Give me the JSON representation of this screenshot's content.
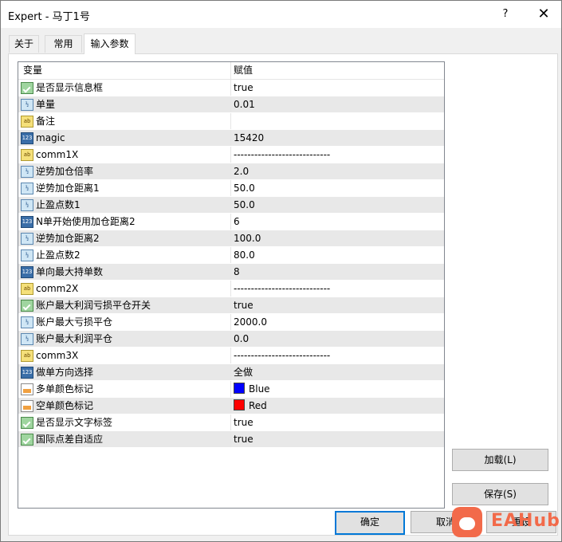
{
  "window": {
    "title": "Expert - 马丁1号",
    "help_icon": "?",
    "close_icon": "✕"
  },
  "tabs": [
    {
      "label": "关于",
      "active": false
    },
    {
      "label": "常用",
      "active": false
    },
    {
      "label": "输入参数",
      "active": true
    }
  ],
  "grid": {
    "headers": {
      "variable": "变量",
      "value": "赋值"
    },
    "rows": [
      {
        "icon": "bool-icon",
        "name": "是否显示信息框",
        "value": "true"
      },
      {
        "icon": "double-icon",
        "name": "单量",
        "value": "0.01"
      },
      {
        "icon": "string-icon",
        "name": "备注",
        "value": ""
      },
      {
        "icon": "int-icon",
        "name": "magic",
        "value": "15420"
      },
      {
        "icon": "string-icon",
        "name": "comm1X",
        "value": "----------------------------"
      },
      {
        "icon": "double-icon",
        "name": "逆势加仓倍率",
        "value": "2.0"
      },
      {
        "icon": "double-icon",
        "name": "逆势加仓距离1",
        "value": "50.0"
      },
      {
        "icon": "double-icon",
        "name": "止盈点数1",
        "value": "50.0"
      },
      {
        "icon": "int-icon",
        "name": "N单开始使用加仓距离2",
        "value": "6"
      },
      {
        "icon": "double-icon",
        "name": "逆势加仓距离2",
        "value": "100.0"
      },
      {
        "icon": "double-icon",
        "name": "止盈点数2",
        "value": "80.0"
      },
      {
        "icon": "int-icon",
        "name": "单向最大持单数",
        "value": "8"
      },
      {
        "icon": "string-icon",
        "name": "comm2X",
        "value": "----------------------------"
      },
      {
        "icon": "bool-icon",
        "name": "账户最大利润亏损平仓开关",
        "value": "true"
      },
      {
        "icon": "double-icon",
        "name": "账户最大亏损平仓",
        "value": "2000.0"
      },
      {
        "icon": "double-icon",
        "name": "账户最大利润平仓",
        "value": "0.0"
      },
      {
        "icon": "string-icon",
        "name": "comm3X",
        "value": "----------------------------"
      },
      {
        "icon": "int-icon",
        "name": "做单方向选择",
        "value": "全做"
      },
      {
        "icon": "color-icon",
        "name": "多单颜色标记",
        "value": "Blue",
        "swatch": "#0000ff"
      },
      {
        "icon": "color-icon",
        "name": "空单颜色标记",
        "value": "Red",
        "swatch": "#ff0000"
      },
      {
        "icon": "bool-icon",
        "name": "是否显示文字标签",
        "value": "true"
      },
      {
        "icon": "bool-icon",
        "name": "国际点差自适应",
        "value": "true"
      }
    ]
  },
  "buttons": {
    "load": "加载(L)",
    "save": "保存(S)",
    "ok": "确定",
    "cancel": "取消",
    "reset": "重设"
  },
  "watermark": {
    "text": "EAHub"
  },
  "colors": {
    "accent": "#0078d7",
    "alt_row": "#e8e8e8",
    "watermark": "#f26a4a"
  }
}
